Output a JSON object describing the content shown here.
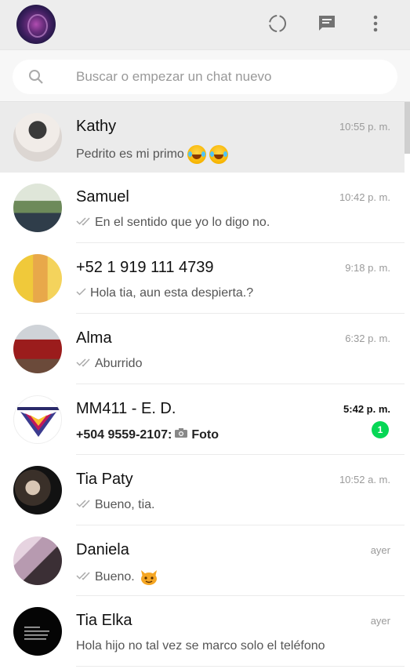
{
  "search": {
    "placeholder": "Buscar o empezar un chat nuevo"
  },
  "chats": [
    {
      "name": "Kathy",
      "time": "10:55 p. m.",
      "preview": "Pedrito es mi primo",
      "ticks": "none",
      "emoji": "joy-emoji x2",
      "active": true
    },
    {
      "name": "Samuel",
      "time": "10:42 p. m.",
      "preview": "En el sentido que yo lo digo no.",
      "ticks": "double"
    },
    {
      "name": "+52 1 919 111 4739",
      "time": "9:18 p. m.",
      "preview": "Hola tia, aun esta despierta.?",
      "ticks": "single"
    },
    {
      "name": "Alma",
      "time": "6:32 p. m.",
      "preview": "Aburrido",
      "ticks": "double"
    },
    {
      "name": "MM411 - E. D.",
      "time": "5:42 p. m.",
      "preview_sender": "+504 9559-2107:",
      "preview": "Foto",
      "ticks": "none",
      "unread_count": "1"
    },
    {
      "name": "Tia Paty",
      "time": "10:52 a. m.",
      "preview": "Bueno, tia.",
      "ticks": "double"
    },
    {
      "name": "Daniela",
      "time": "ayer",
      "preview": "Bueno.",
      "ticks": "double",
      "emoji": "cat-emoji"
    },
    {
      "name": "Tia Elka",
      "time": "ayer",
      "preview": "Hola hijo no tal vez se marco solo el teléfono",
      "ticks": "none"
    }
  ],
  "colors": {
    "unread_badge": "#06d755",
    "header_bg": "#ededed",
    "active_row": "#ebebeb"
  }
}
